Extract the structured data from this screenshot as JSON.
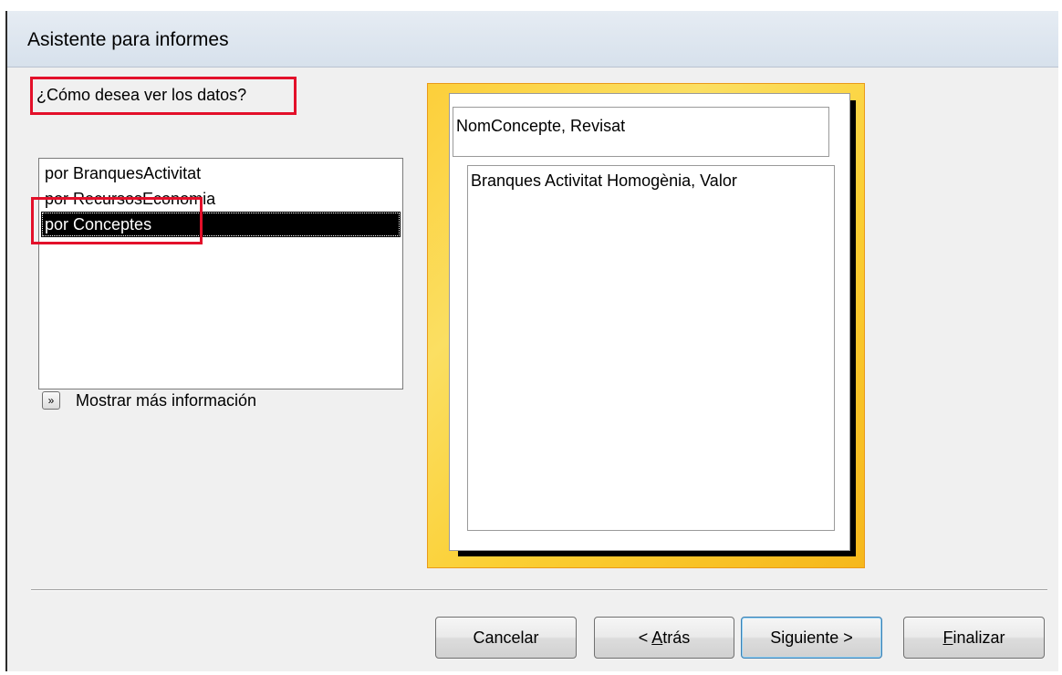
{
  "window": {
    "title": "Asistente para informes"
  },
  "question": "¿Cómo desea ver los datos?",
  "list": {
    "items": [
      {
        "label": "por BranquesActivitat",
        "selected": false
      },
      {
        "label": "por RecursosEconomia",
        "selected": false
      },
      {
        "label": "por Conceptes",
        "selected": true
      }
    ]
  },
  "more_info": {
    "icon": "double-chevron-down-icon",
    "label": "Mostrar más información"
  },
  "preview": {
    "group_header": "NomConcepte, Revisat",
    "detail": "Branques Activitat Homogènia, Valor"
  },
  "buttons": {
    "cancel": "Cancelar",
    "back_prefix": "< ",
    "back_mnemonic": "A",
    "back_rest": "trás",
    "next_prefix": "Si",
    "next_mnemonic": "g",
    "next_rest": "uiente >",
    "finish_mnemonic": "F",
    "finish_rest": "inalizar"
  },
  "colors": {
    "highlight_red": "#e3102a",
    "preview_gold": "#fbcf33",
    "selection": "#000000"
  }
}
